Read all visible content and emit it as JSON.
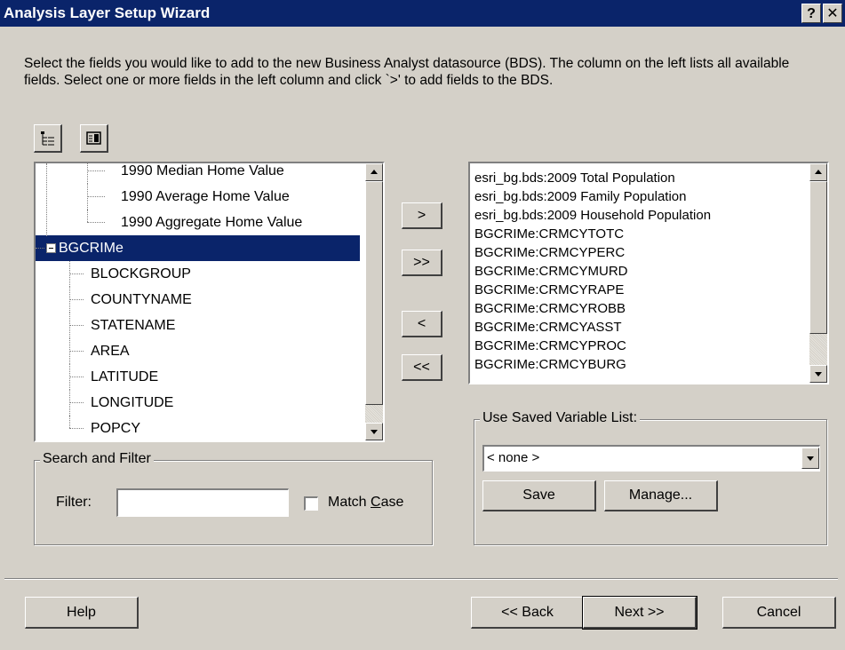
{
  "window": {
    "title": "Analysis Layer Setup Wizard",
    "help_glyph": "?",
    "close_glyph": "✕"
  },
  "intro_text": "Select the fields you would like to add to the new Business Analyst datasource (BDS).  The column on the left lists all available fields.  Select one or more fields in the left column and click `>' to add fields to the BDS.",
  "toolbar": {
    "tree_view_icon": "tree-view-icon",
    "list_view_icon": "list-view-icon"
  },
  "available_fields": {
    "rows": [
      {
        "label": "1990 Median Home Value"
      },
      {
        "label": "1990 Average Home Value"
      },
      {
        "label": "1990 Aggregate Home Value"
      },
      {
        "label": "BGCRIMe",
        "selected": true,
        "expander": "-"
      },
      {
        "label": "BLOCKGROUP"
      },
      {
        "label": "COUNTYNAME"
      },
      {
        "label": "STATENAME"
      },
      {
        "label": "AREA"
      },
      {
        "label": "LATITUDE"
      },
      {
        "label": "LONGITUDE"
      },
      {
        "label": "POPCY"
      }
    ]
  },
  "transfer_buttons": {
    "add": ">",
    "add_all": ">>",
    "remove": "<",
    "remove_all": "<<"
  },
  "selected_fields": {
    "items": [
      "esri_bg.bds:2009 Total Population",
      "esri_bg.bds:2009 Family Population",
      "esri_bg.bds:2009 Household Population",
      "BGCRIMe:CRMCYTOTC",
      "BGCRIMe:CRMCYPERC",
      "BGCRIMe:CRMCYMURD",
      "BGCRIMe:CRMCYRAPE",
      "BGCRIMe:CRMCYROBB",
      "BGCRIMe:CRMCYASST",
      "BGCRIMe:CRMCYPROC",
      "BGCRIMe:CRMCYBURG"
    ]
  },
  "search_filter": {
    "legend": "Search and Filter",
    "filter_label": "Filter:",
    "filter_value": "",
    "match_case_prefix": "Match ",
    "match_case_accel": "C",
    "match_case_suffix": "ase",
    "match_case_checked": false
  },
  "saved_list": {
    "legend": "Use Saved Variable List:",
    "selected": "< none >",
    "save_label": "Save",
    "manage_label": "Manage..."
  },
  "footer": {
    "help_label": "Help",
    "back_label": "<< Back",
    "next_label": "Next >>",
    "cancel_label": "Cancel"
  }
}
